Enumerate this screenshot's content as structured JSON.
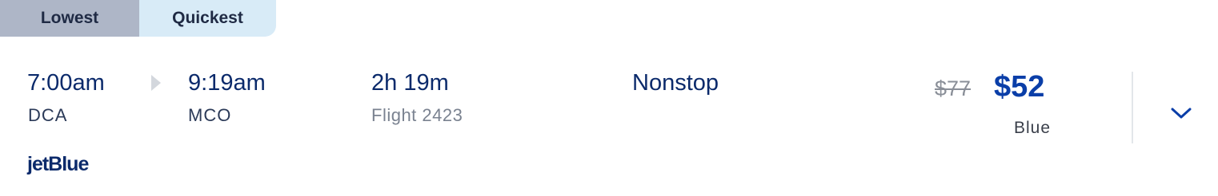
{
  "sort_tabs": {
    "lowest_label": "Lowest",
    "quickest_label": "Quickest",
    "selected": "Quickest"
  },
  "flight": {
    "departure_time": "7:00am",
    "departure_code": "DCA",
    "arrival_time": "9:19am",
    "arrival_code": "MCO",
    "duration": "2h 19m",
    "flight_number": "Flight 2423",
    "stops": "Nonstop",
    "original_price": "$77",
    "price": "$52",
    "fare_class": "Blue",
    "airline_logo_text": "jetBlue"
  },
  "colors": {
    "tab_lowest_bg": "#aeb6c7",
    "tab_quickest_bg": "#d8ebf7",
    "primary_text": "#0b2a6b",
    "price_accent": "#0a3ea8"
  },
  "icons": {
    "route_arrow": "triangle-right-icon",
    "expand": "chevron-down-icon"
  }
}
